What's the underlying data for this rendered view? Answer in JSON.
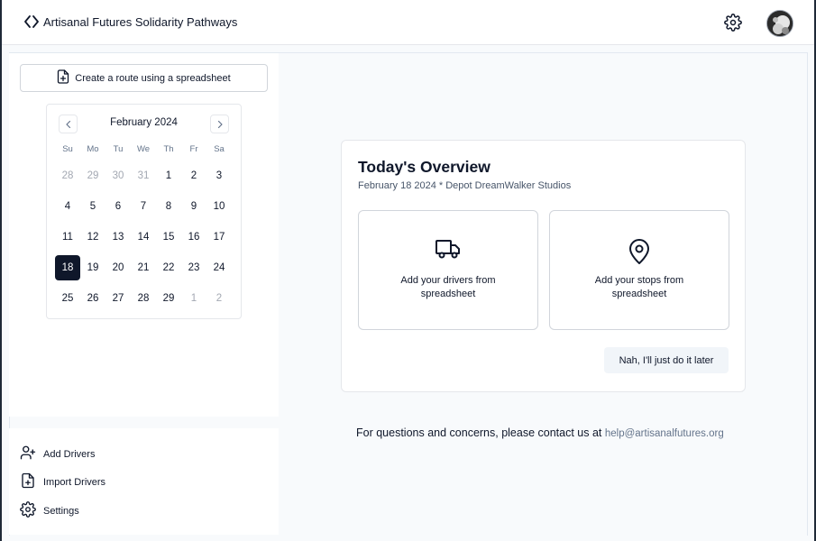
{
  "header": {
    "title": "Artisanal Futures Solidarity Pathways",
    "brand_icon": "code-brackets-icon",
    "settings_icon": "gear-icon",
    "avatar_icon": "user-avatar"
  },
  "sidebar": {
    "spreadsheet_button": "Create a route using a spreadsheet",
    "calendar": {
      "month_label": "February 2024",
      "weekdays": [
        "Su",
        "Mo",
        "Tu",
        "We",
        "Th",
        "Fr",
        "Sa"
      ],
      "weeks": [
        [
          "28",
          "29",
          "30",
          "31",
          "1",
          "2",
          "3"
        ],
        [
          "4",
          "5",
          "6",
          "7",
          "8",
          "9",
          "10"
        ],
        [
          "11",
          "12",
          "13",
          "14",
          "15",
          "16",
          "17"
        ],
        [
          "18",
          "19",
          "20",
          "21",
          "22",
          "23",
          "24"
        ],
        [
          "25",
          "26",
          "27",
          "28",
          "29",
          "1",
          "2"
        ]
      ],
      "selected_day": "18"
    },
    "links": {
      "add_drivers": "Add Drivers",
      "import_drivers": "Import Drivers",
      "settings": "Settings"
    }
  },
  "overview": {
    "title": "Today's Overview",
    "subtitle": "February 18 2024 * Depot DreamWalker Studios",
    "drivers_tile": "Add your drivers from spreadsheet",
    "stops_tile": "Add your stops from spreadsheet",
    "later_button": "Nah, I'll just do it later"
  },
  "footer": {
    "contact_text": "For questions and concerns, please contact us at",
    "contact_email": "help@artisanalfutures.org"
  },
  "colors": {
    "selected_day_bg": "#0f172a",
    "link": "#64748b",
    "backdrop": "#f8fafc"
  }
}
